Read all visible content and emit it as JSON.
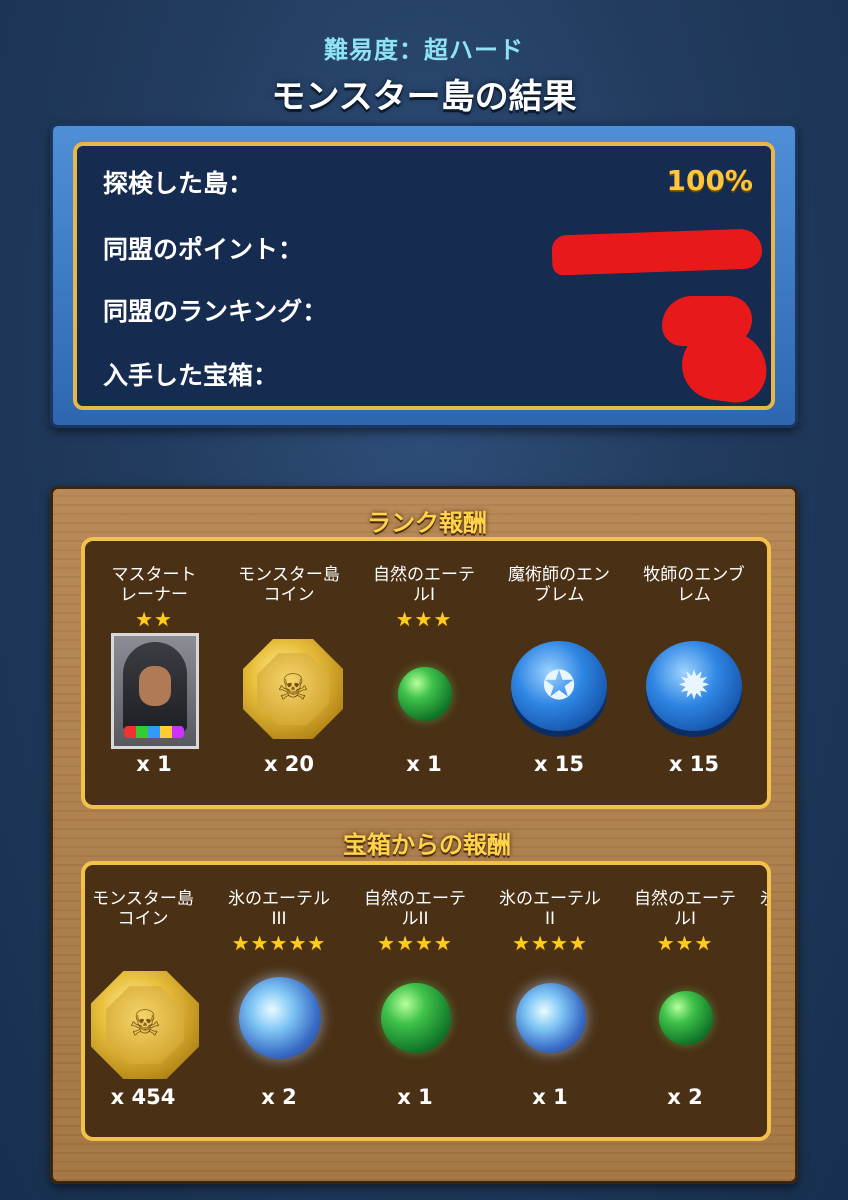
{
  "header": {
    "difficulty": "難易度：超ハード",
    "title": "モンスター島の結果"
  },
  "stats": {
    "explored_label": "探検した島：",
    "explored_value": "100%",
    "alliance_points_label": "同盟のポイント：",
    "alliance_ranking_label": "同盟のランキング：",
    "chests_label": "入手した宝箱："
  },
  "rank_rewards": {
    "title": "ランク報酬",
    "items": [
      {
        "name": "マスタート\nレーナー",
        "stars": "★★",
        "qty": "x 1",
        "icon": "master-trainer-portrait"
      },
      {
        "name": "モンスター島\nコイン",
        "stars": "",
        "qty": "x 20",
        "icon": "monster-island-coin"
      },
      {
        "name": "自然のエーテ\nルⅠ",
        "stars": "★★★",
        "qty": "x 1",
        "icon": "nature-aether-orb"
      },
      {
        "name": "魔術師のエン\nブレム",
        "stars": "",
        "qty": "x 15",
        "icon": "wizard-emblem"
      },
      {
        "name": "牧師のエンブ\nレム",
        "stars": "",
        "qty": "x 15",
        "icon": "cleric-emblem"
      }
    ]
  },
  "chest_rewards": {
    "title": "宝箱からの報酬",
    "items": [
      {
        "name": "モンスター島\nコイン",
        "stars": "",
        "qty": "x 454",
        "icon": "monster-island-coin"
      },
      {
        "name": "氷のエーテル\nIII",
        "stars": "★★★★★",
        "qty": "x 2",
        "icon": "ice-aether-orb"
      },
      {
        "name": "自然のエーテ\nルII",
        "stars": "★★★★",
        "qty": "x 1",
        "icon": "nature-aether-orb"
      },
      {
        "name": "氷のエーテル\nII",
        "stars": "★★★★",
        "qty": "x 1",
        "icon": "ice-aether-orb"
      },
      {
        "name": "自然のエーテ\nルⅠ",
        "stars": "★★★",
        "qty": "x 2",
        "icon": "nature-aether-orb"
      },
      {
        "name": "氷",
        "stars": "",
        "qty": "",
        "icon": "ice-aether-orb"
      }
    ]
  },
  "colors": {
    "gold": "#ffc53d",
    "panel_blue": "#152b4f",
    "frame_gold": "#e5b84c",
    "redaction": "#e8191a"
  }
}
